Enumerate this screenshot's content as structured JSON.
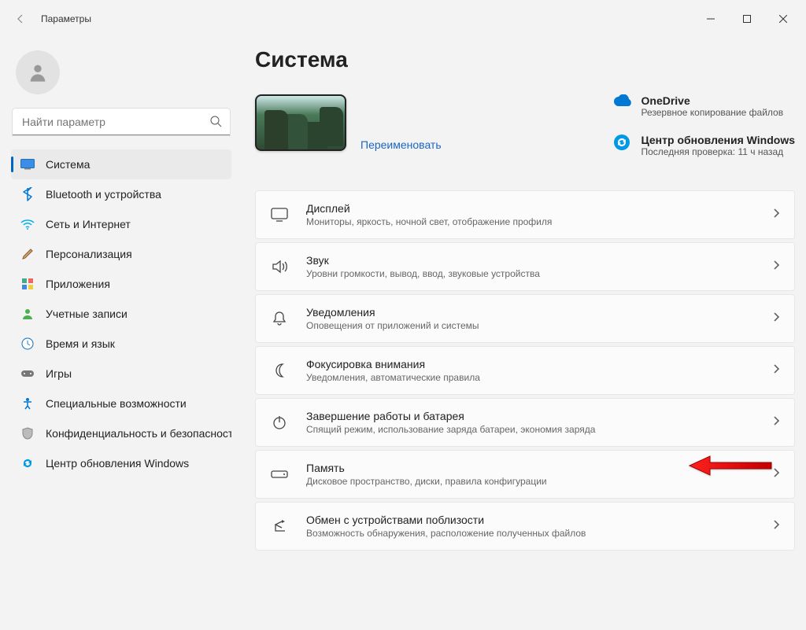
{
  "window": {
    "title": "Параметры"
  },
  "search": {
    "placeholder": "Найти параметр"
  },
  "nav": {
    "items": [
      {
        "label": "Система"
      },
      {
        "label": "Bluetooth и устройства"
      },
      {
        "label": "Сеть и Интернет"
      },
      {
        "label": "Персонализация"
      },
      {
        "label": "Приложения"
      },
      {
        "label": "Учетные записи"
      },
      {
        "label": "Время и язык"
      },
      {
        "label": "Игры"
      },
      {
        "label": "Специальные возможности"
      },
      {
        "label": "Конфиденциальность и безопасность"
      },
      {
        "label": "Центр обновления Windows"
      }
    ]
  },
  "page": {
    "title": "Система",
    "rename": "Переименовать",
    "onedrive": {
      "title": "OneDrive",
      "sub": "Резервное копирование файлов"
    },
    "update": {
      "title": "Центр обновления Windows",
      "sub": "Последняя проверка: 11 ч назад"
    }
  },
  "tiles": [
    {
      "title": "Дисплей",
      "sub": "Мониторы, яркость, ночной свет, отображение профиля",
      "icon": "display"
    },
    {
      "title": "Звук",
      "sub": "Уровни громкости, вывод, ввод, звуковые устройства",
      "icon": "sound"
    },
    {
      "title": "Уведомления",
      "sub": "Оповещения от приложений и системы",
      "icon": "bell"
    },
    {
      "title": "Фокусировка внимания",
      "sub": "Уведомления, автоматические правила",
      "icon": "moon"
    },
    {
      "title": "Завершение работы и батарея",
      "sub": "Спящий режим, использование заряда батареи, экономия заряда",
      "icon": "power"
    },
    {
      "title": "Память",
      "sub": "Дисковое пространство, диски, правила конфигурации",
      "icon": "storage"
    },
    {
      "title": "Обмен с устройствами поблизости",
      "sub": "Возможность обнаружения, расположение полученных файлов",
      "icon": "share"
    }
  ]
}
